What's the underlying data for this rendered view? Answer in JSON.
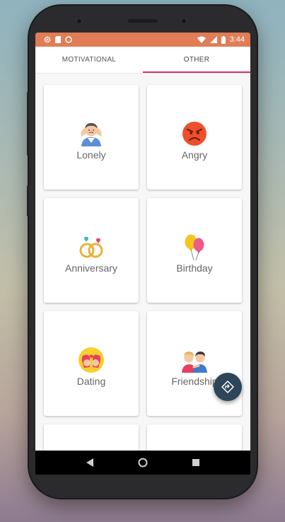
{
  "status_bar": {
    "time": "3:44",
    "icons_left": [
      "gear-icon",
      "sim-icon",
      "circle-icon"
    ],
    "icons_right": [
      "wifi-icon",
      "signal-icon",
      "battery-icon"
    ],
    "color": "#e07d56"
  },
  "tabs": [
    {
      "label": "MOTIVATIONAL",
      "active": false
    },
    {
      "label": "OTHER",
      "active": true
    }
  ],
  "accent_color": "#d8336a",
  "categories": [
    {
      "label": "Lonely",
      "icon": "lonely-person-icon"
    },
    {
      "label": "Angry",
      "icon": "angry-face-icon"
    },
    {
      "label": "Anniversary",
      "icon": "rings-icon"
    },
    {
      "label": "Birthday",
      "icon": "balloons-icon"
    },
    {
      "label": "Dating",
      "icon": "couple-face-icon"
    },
    {
      "label": "Friendship",
      "icon": "friends-icon"
    }
  ],
  "fab": {
    "icon": "diamond-direction-icon",
    "color": "#2e4659"
  },
  "navigation": {
    "buttons": [
      "back-icon",
      "home-icon",
      "recents-icon"
    ]
  }
}
